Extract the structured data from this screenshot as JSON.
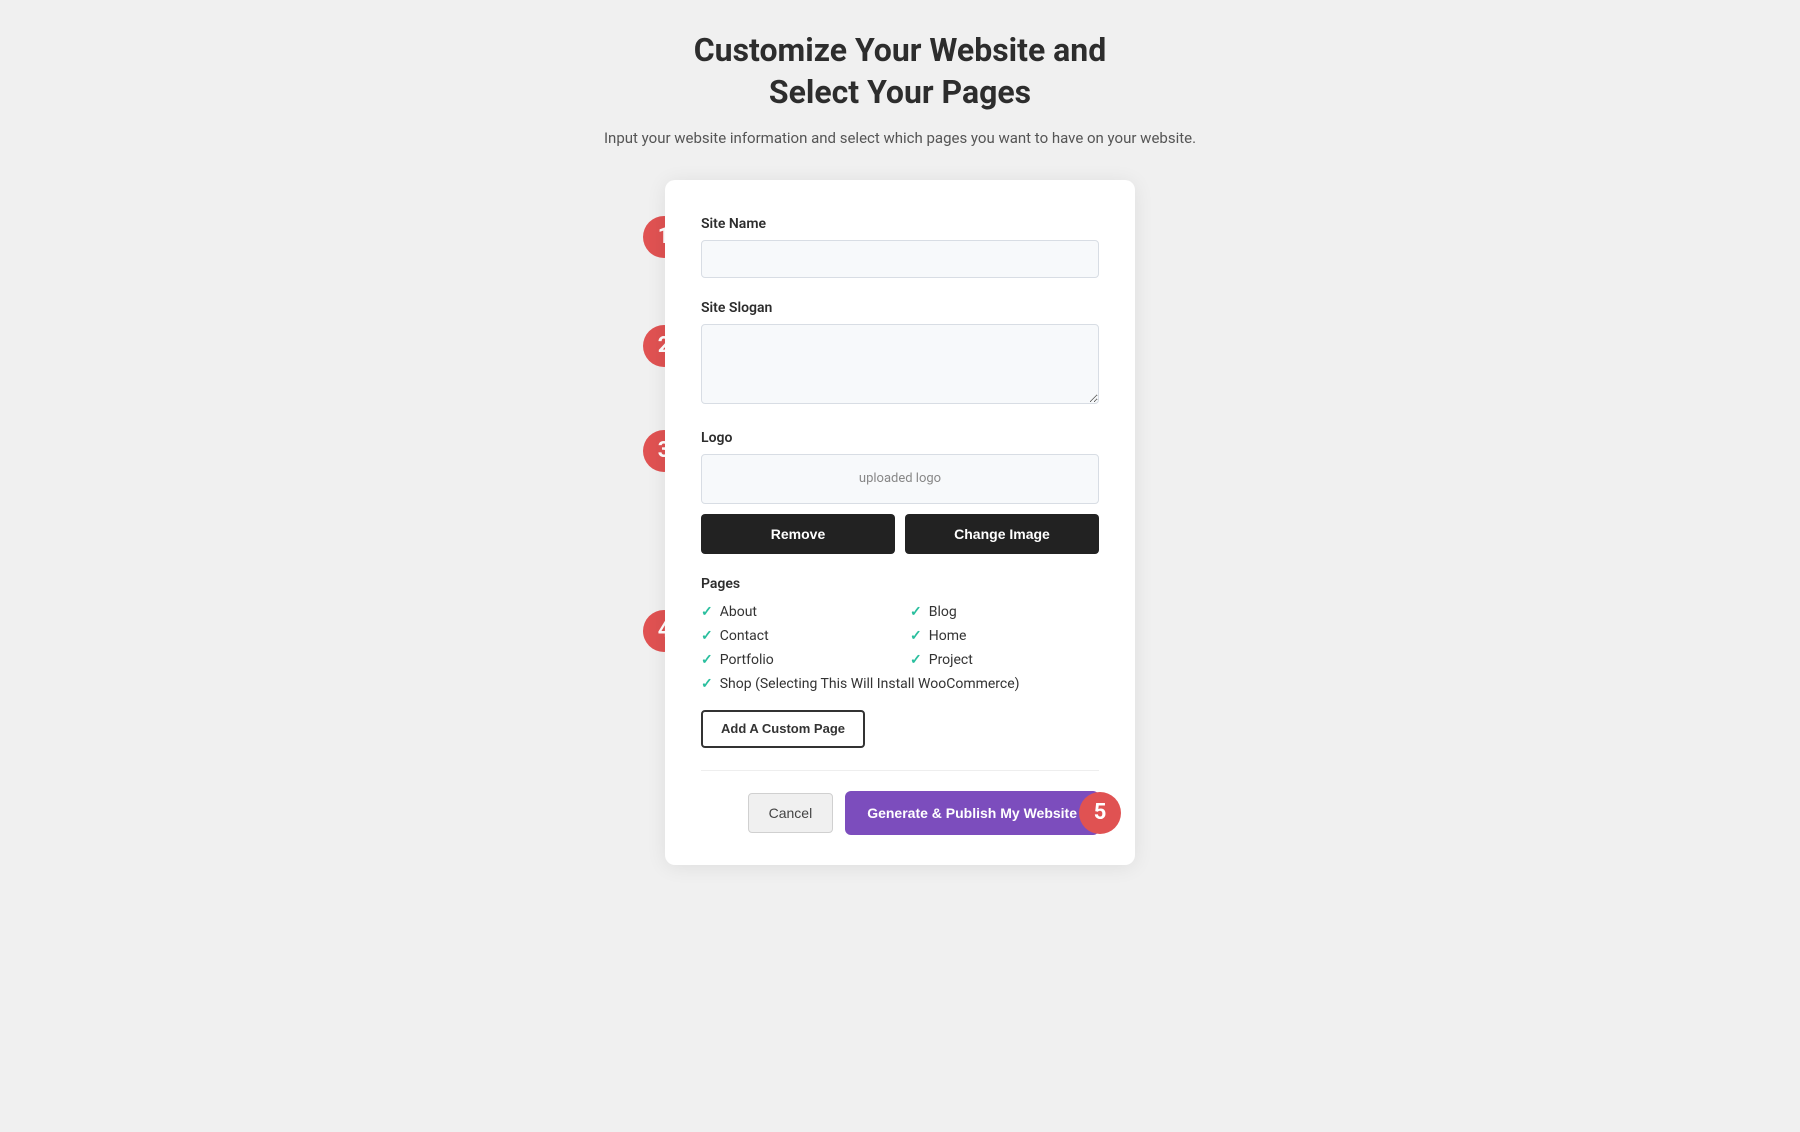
{
  "header": {
    "title_line1": "Customize Your Website and",
    "title_line2": "Select Your Pages",
    "subtitle": "Input your website information and select which pages you want to have on your website."
  },
  "form": {
    "site_name_label": "Site Name",
    "site_name_placeholder": "",
    "site_slogan_label": "Site Slogan",
    "site_slogan_placeholder": "",
    "logo_label": "Logo",
    "logo_placeholder": "uploaded logo",
    "remove_button": "Remove",
    "change_image_button": "Change Image",
    "pages_label": "Pages",
    "pages": [
      {
        "label": "About",
        "checked": true,
        "column": "left"
      },
      {
        "label": "Blog",
        "checked": true,
        "column": "right"
      },
      {
        "label": "Contact",
        "checked": true,
        "column": "left"
      },
      {
        "label": "Home",
        "checked": true,
        "column": "right"
      },
      {
        "label": "Portfolio",
        "checked": true,
        "column": "left"
      },
      {
        "label": "Project",
        "checked": true,
        "column": "right"
      },
      {
        "label": "Shop (Selecting This Will Install WooCommerce)",
        "checked": true,
        "column": "full"
      }
    ],
    "add_custom_page_button": "Add A Custom Page",
    "cancel_button": "Cancel",
    "generate_button": "Generate & Publish My Website"
  },
  "steps": {
    "step1": "1",
    "step2": "2",
    "step3": "3",
    "step4": "4",
    "step5": "5"
  },
  "icons": {
    "check": "✓"
  }
}
